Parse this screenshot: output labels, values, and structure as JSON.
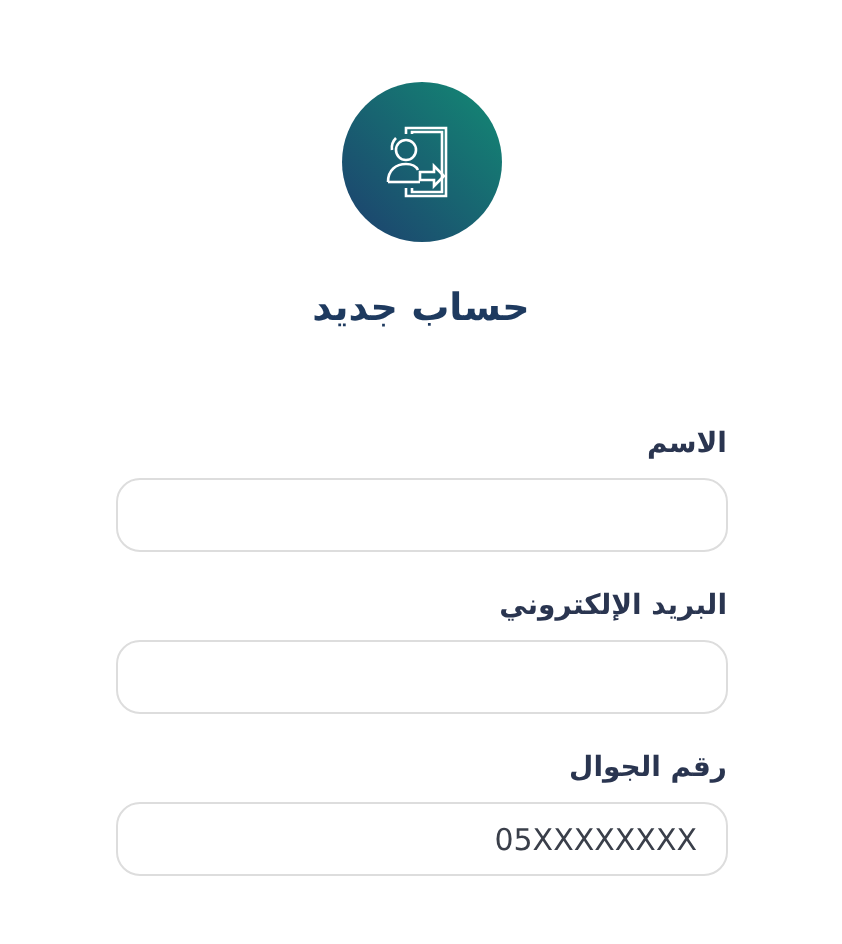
{
  "title": "حساب جديد",
  "fields": [
    {
      "label": "الاسم"
    },
    {
      "label": "البريد الإلكتروني"
    },
    {
      "label": "رقم الجوال",
      "placeholder": "05XXXXXXXX"
    }
  ]
}
